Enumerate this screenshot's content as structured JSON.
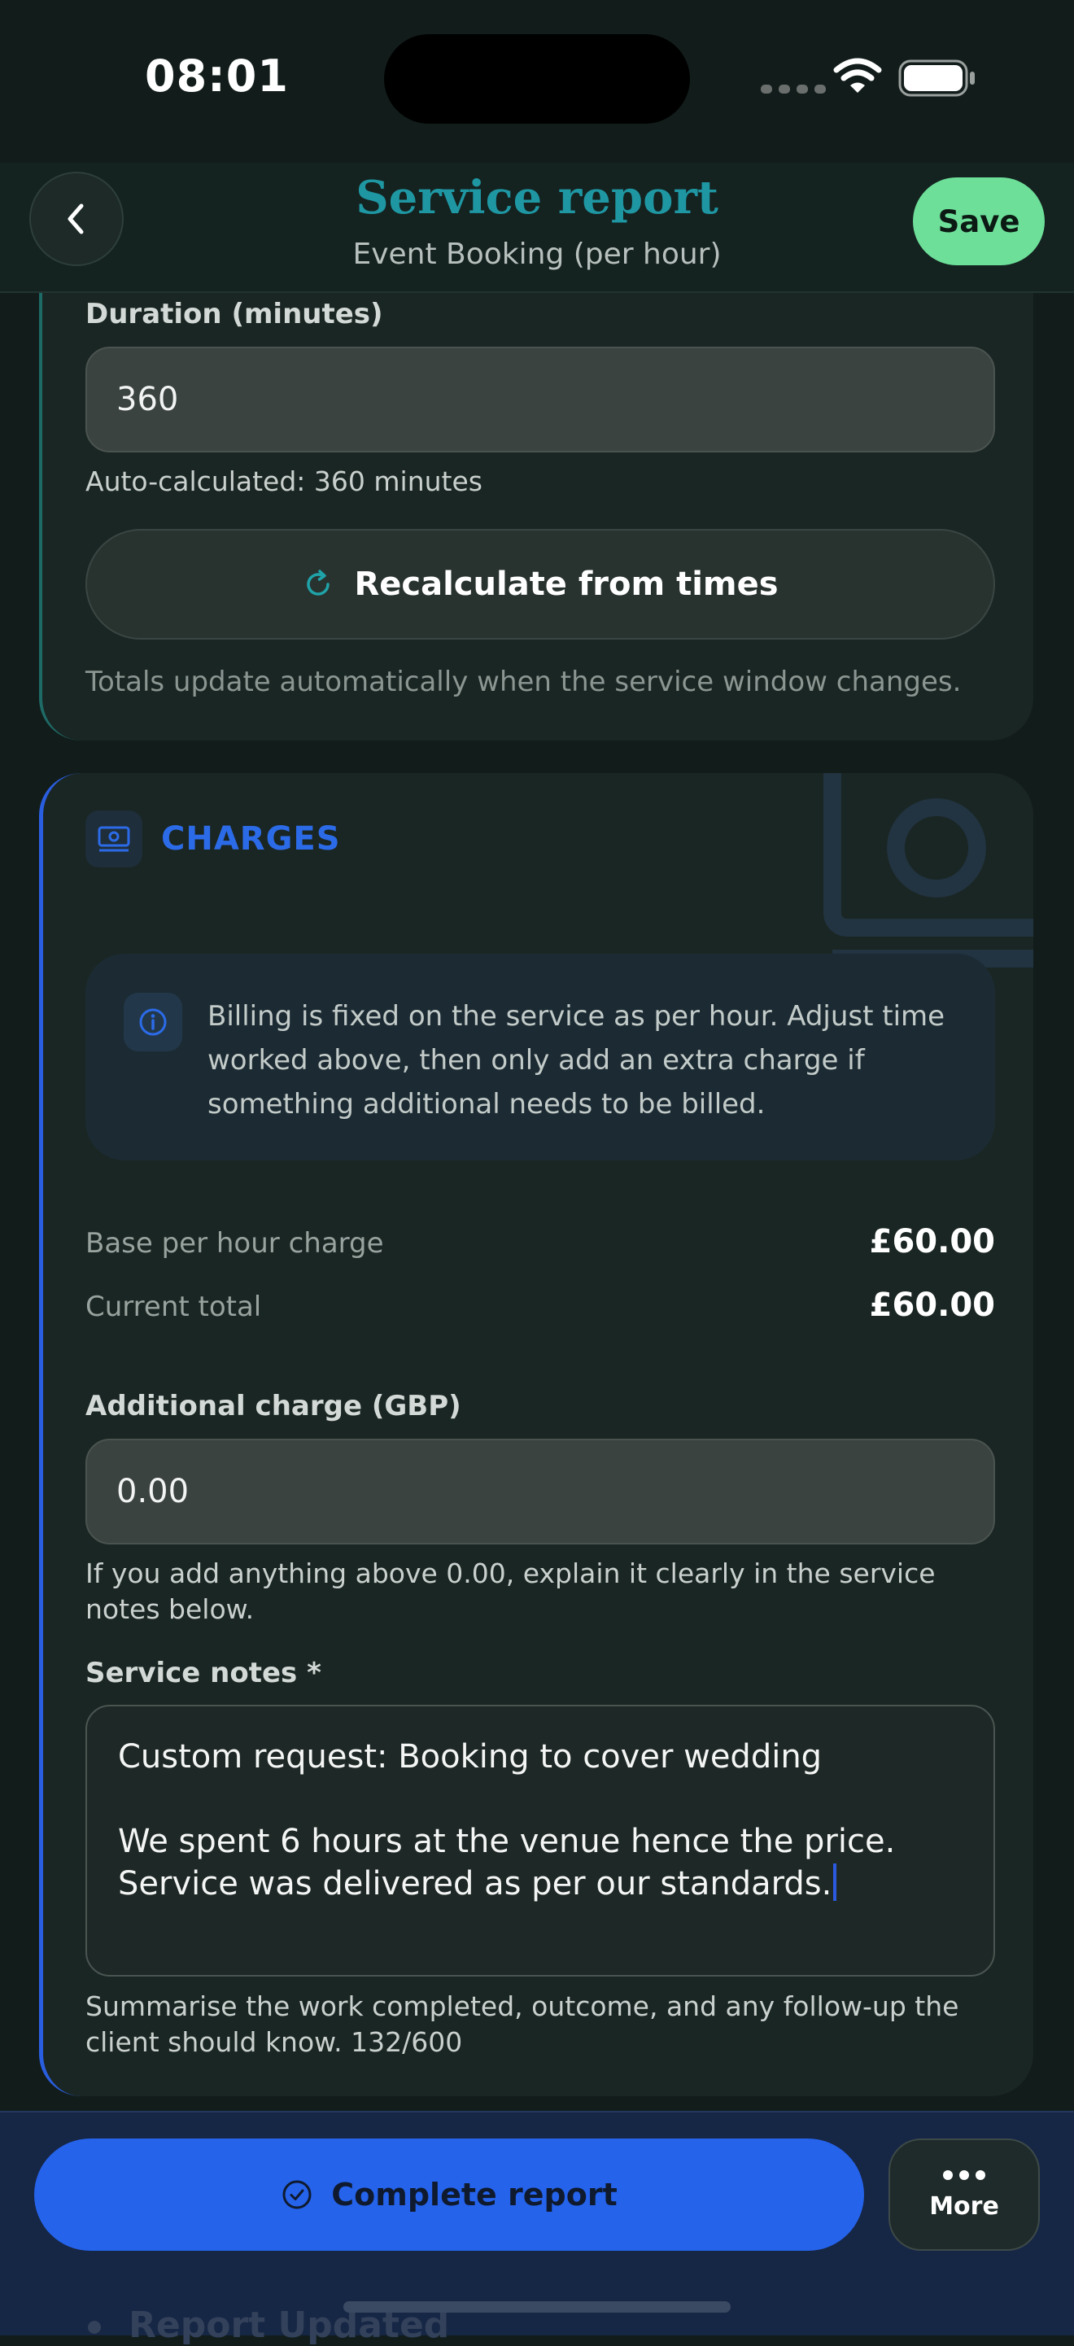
{
  "status_bar": {
    "time": "08:01"
  },
  "header": {
    "title": "Service report",
    "subtitle": "Event Booking (per hour)",
    "save_label": "Save"
  },
  "duration": {
    "label": "Duration (minutes)",
    "value": "360",
    "auto_calc": "Auto-calculated: 360 minutes",
    "recalc_label": "Recalculate from times",
    "note": "Totals update automatically when the service window changes."
  },
  "charges": {
    "title": "CHARGES",
    "info": "Billing is fixed on the service as per hour. Adjust time worked above, then only add an extra charge if something additional needs to be billed.",
    "base_label": "Base per hour charge",
    "base_value": "£60.00",
    "total_label": "Current total",
    "total_value": "£60.00",
    "additional_label": "Additional charge (GBP)",
    "additional_value": "0.00",
    "additional_helper": "If you add anything above 0.00, explain it clearly in the service notes below.",
    "notes_label": "Service notes *",
    "notes_text": "Custom request: Booking to cover wedding\n\nWe spent 6 hours at the venue hence the price. Service was delivered as per our standards.",
    "notes_helper": "Summarise the work completed, outcome, and any follow-up the client should know. 132/600"
  },
  "bottom": {
    "complete_label": "Complete report",
    "more_label": "More",
    "behind_text": "Report Updated"
  },
  "colors": {
    "accent_teal": "#1f97a3",
    "save_green": "#6ddf99",
    "primary_blue": "#2563eb",
    "background": "#121d1b"
  },
  "icons": [
    "back-chevron-icon",
    "refresh-icon",
    "banknote-icon",
    "info-icon",
    "check-circle-icon",
    "ellipsis-icon",
    "wifi-icon",
    "battery-icon"
  ]
}
